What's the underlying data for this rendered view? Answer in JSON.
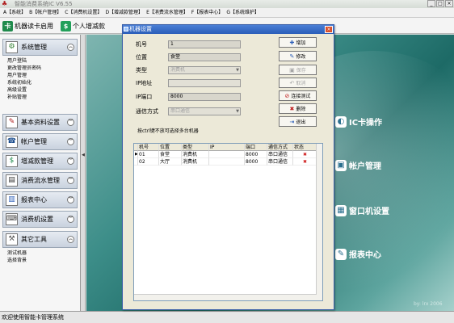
{
  "app": {
    "title": "智能消费系统IC V6.55",
    "minimize": "_",
    "maximize": "□",
    "close": "×"
  },
  "menu": [
    "A【系统】",
    "B【帐户管理】",
    "C【消费机设置】",
    "D【增减款管理】",
    "E【消费流水管理】",
    "F【报表中心】",
    "G【系统维护】"
  ],
  "toolbar": {
    "items": [
      {
        "label": "机器读卡启用",
        "icon": "card-reader-icon",
        "glyph": "卡"
      },
      {
        "label": "个人增减款",
        "icon": "money-icon",
        "glyph": "$"
      }
    ]
  },
  "sidebar": {
    "sections": [
      {
        "label": "系统管理",
        "icon": "system-icon",
        "glyph": "⚙",
        "chevron": "︽"
      },
      {
        "label": "基本资料设置",
        "icon": "pencil-icon",
        "glyph": "✎",
        "chevron": "︾"
      },
      {
        "label": "帐户管理",
        "icon": "phone-icon",
        "glyph": "☎",
        "chevron": "︾"
      },
      {
        "label": "增减款管理",
        "icon": "money-icon",
        "glyph": "$",
        "chevron": "︾"
      },
      {
        "label": "消费流水管理",
        "icon": "ledger-icon",
        "glyph": "▤",
        "chevron": "︾"
      },
      {
        "label": "报表中心",
        "icon": "report-icon",
        "glyph": "▥",
        "chevron": "︾"
      },
      {
        "label": "消费机设置",
        "icon": "terminal-icon",
        "glyph": "⌨",
        "chevron": "︾"
      },
      {
        "label": "其它工具",
        "icon": "tools-icon",
        "glyph": "⚒",
        "chevron": "︽"
      }
    ],
    "system_items": [
      "用户登陆",
      "更改管理员密码",
      "用户管理",
      "系统初始化",
      "高级设置",
      "补贴管理"
    ],
    "tools_items": [
      "测试机器",
      "选择背景"
    ]
  },
  "desktop": {
    "links": [
      {
        "label": "IC卡操作",
        "icon": "ic-card-icon",
        "glyph": "◐"
      },
      {
        "label": "帐户管理",
        "icon": "account-icon",
        "glyph": "▣"
      },
      {
        "label": "窗口机设置",
        "icon": "window-terminal-icon",
        "glyph": "▦"
      },
      {
        "label": "报表中心",
        "icon": "report-icon",
        "glyph": "✎"
      }
    ],
    "watermark": "by: lrx 2006"
  },
  "dialog": {
    "title": "机器设置",
    "close": "×",
    "fields": [
      {
        "label": "机号",
        "value": "1",
        "state": "ro"
      },
      {
        "label": "位置",
        "value": "食堂",
        "state": "ro"
      },
      {
        "label": "类型",
        "value": "消费机",
        "state": "dis",
        "select": true
      },
      {
        "label": "IP地址",
        "value": "",
        "state": "dis"
      },
      {
        "label": "IP端口",
        "value": "8000",
        "state": "ro"
      },
      {
        "label": "通信方式",
        "value": "串口通信",
        "state": "dis",
        "select": true
      }
    ],
    "buttons": [
      {
        "label": "增加",
        "icon": "add-icon",
        "glyph": "✚",
        "enabled": true
      },
      {
        "label": "修改",
        "icon": "edit-icon",
        "glyph": "✎",
        "enabled": true
      },
      {
        "label": "保存",
        "icon": "save-icon",
        "glyph": "▣",
        "enabled": false
      },
      {
        "label": "取消",
        "icon": "cancel-icon",
        "glyph": "↶",
        "enabled": false
      },
      {
        "label": "连接测试",
        "icon": "connect-test-icon",
        "glyph": "⊘",
        "enabled": true
      },
      {
        "label": "删除",
        "icon": "delete-icon",
        "glyph": "✖",
        "enabled": true
      },
      {
        "label": "退出",
        "icon": "exit-icon",
        "glyph": "⇥",
        "enabled": true
      }
    ],
    "hint": "按ctrl键不放可选择多台机器",
    "table": {
      "columns": [
        "机号",
        "位置",
        "类型",
        "IP",
        "端口",
        "通信方式",
        "状态"
      ],
      "rows": [
        {
          "marker": "▶",
          "cells": [
            "01",
            "食堂",
            "消费机",
            "",
            "8000",
            "串口通信"
          ],
          "status": "✖"
        },
        {
          "marker": "",
          "cells": [
            "02",
            "大厅",
            "消费机",
            "",
            "8000",
            "串口通信"
          ],
          "status": "✖"
        }
      ]
    }
  },
  "status": {
    "text": "欢迎使用智能卡管理系统"
  },
  "colors": {
    "title_bar": "#2a5db8",
    "desktop": "#3d8e89",
    "status_error": "#d02020"
  }
}
